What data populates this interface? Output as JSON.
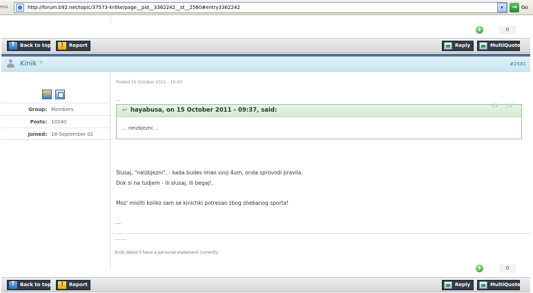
{
  "browser": {
    "address_label": "ess",
    "url": "http://forum.b92.net/topic/37573-kritke/page__pid__3362242__st__2560#entry3362242",
    "dropdown_glyph": "▾",
    "go_label": "Go"
  },
  "reputation": {
    "top": {
      "plus_glyph": "+",
      "count": "0"
    },
    "bottom": {
      "plus_glyph": "+",
      "count": "0"
    }
  },
  "buttons": {
    "back_to_top": "Back to top",
    "report": "Report",
    "reply": "Reply",
    "multiquote": "MultiQuote"
  },
  "post": {
    "author": "Kinik",
    "online_glyph": "⊗",
    "number": "#2581",
    "posted": "Posted 15 October 2011 - 10:03",
    "ellipsis_top": "...",
    "quote": {
      "citation": "hayabusa, on 15 October 2011 - 09:37, said:",
      "arrow_glyph": "↩",
      "marks": "“ ”",
      "text": "... neizbjezni ..."
    },
    "body": [
      "Slusaj, \"neizbjezni\", - kada budes imao svoj 4um, onda sprovodi pravila.",
      "Dok si na tudjem - ili slusaj, ili begaj!.",
      "Moz' misliti koliko sam se kinichki potresao zbog shebanog sporta!",
      "..."
    ],
    "signature_dashes": "--------",
    "signature": "Kinik doesn't have a personal statement currently"
  },
  "author_info": {
    "group_label": "Group:",
    "group_value": "Members",
    "posts_label": "Posts:",
    "posts_value": "10240",
    "joined_label": "Joined:",
    "joined_value": "18-September 02"
  },
  "icons": {
    "address_page": "page-icon",
    "go": "go-arrow-icon",
    "rep_plus": "plus-circle-icon",
    "back_to_top": "arrow-up-icon",
    "report": "warning-icon",
    "reply": "reply-icon",
    "multiquote": "multiquote-icon",
    "author": "user-icon",
    "online": "offline-status-icon",
    "avatar_1": "profile-icon",
    "avatar_2": "message-icon",
    "quote": "quote-arrow-icon"
  },
  "colors": {
    "header_band": "#4d7096",
    "post_header_bg": "#d6ecf3",
    "author_name": "#2a6f93",
    "button_bg": "#333d48",
    "quote_border": "#97c29b",
    "quote_header_bg": "#dcf0da",
    "bar_bg": "#e2e2e2"
  }
}
